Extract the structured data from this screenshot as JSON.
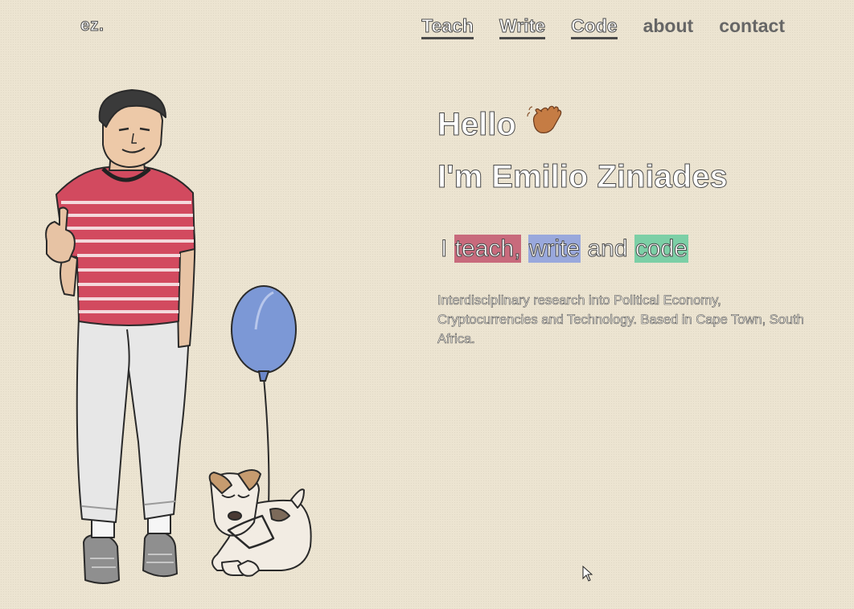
{
  "header": {
    "logo": "ez.",
    "nav": [
      {
        "label": "Teach",
        "underlined": true
      },
      {
        "label": "Write",
        "underlined": true
      },
      {
        "label": "Code",
        "underlined": true
      },
      {
        "label": "about",
        "underlined": false
      },
      {
        "label": "contact",
        "underlined": false
      }
    ]
  },
  "hero": {
    "greeting": "Hello",
    "greeting_icon": "waving-hand-icon",
    "name_line": "I'm Emilio Ziniades",
    "tagline": {
      "prefix": "I",
      "teach": "teach,",
      "write": "write",
      "and": "and",
      "code": "code"
    },
    "description": "Interdisciplinary research into Political Economy, Cryptocurrencies and Technology. Based in Cape Town, South Africa."
  },
  "colors": {
    "background": "#ece4d1",
    "teach_highlight": "#c86a7c",
    "write_highlight": "#99a8dc",
    "code_highlight": "#7ccfa6"
  },
  "illustration": {
    "subjects": [
      "person-figure",
      "dog-figure",
      "balloon-figure"
    ]
  }
}
